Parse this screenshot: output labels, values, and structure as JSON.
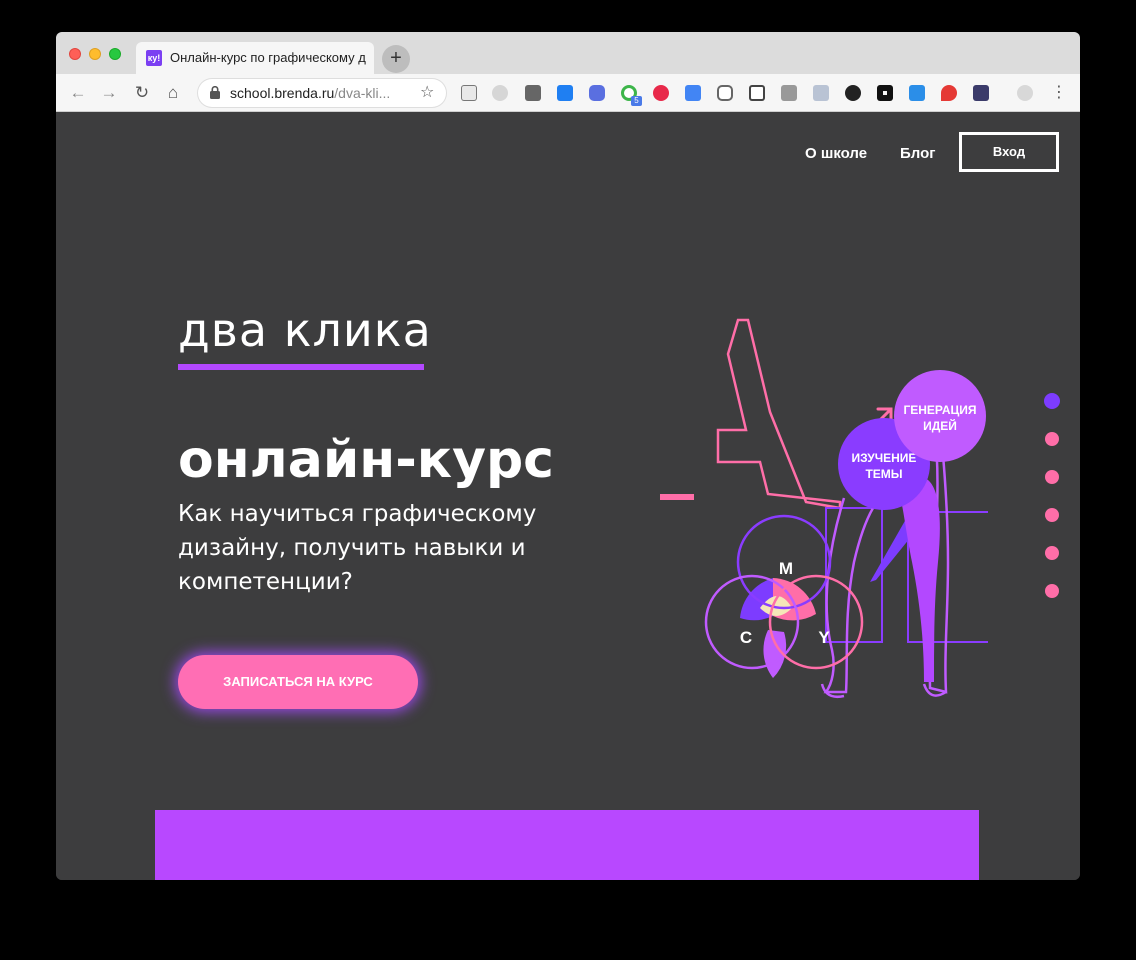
{
  "browser": {
    "tab_favicon": "ку!",
    "tab_title": "Онлайн-курс по графическому дизайну",
    "new_tab_symbol": "+",
    "url_host": "school.brenda.ru",
    "url_path": "/dva-kli..."
  },
  "nav": {
    "about": "О школе",
    "blog": "Блог",
    "login": "Вход"
  },
  "hero": {
    "brand": "два клика",
    "title": "онлайн-курс",
    "subtitle": "Как научиться графическому дизайну, получить навыки и компетенции?",
    "cta": "ЗАПИСАТЬСЯ НА КУРС"
  },
  "illustration": {
    "circle_research_line1": "ИЗУЧЕНИЕ",
    "circle_research_line2": "ТЕМЫ",
    "circle_ideas_line1": "ГЕНЕРАЦИЯ",
    "circle_ideas_line2": "ИДЕЙ",
    "venn_m": "M",
    "venn_c": "C",
    "venn_y": "Y"
  },
  "slider": {
    "slide_count": 6,
    "active_index": 0
  },
  "colors": {
    "background": "#3d3d3e",
    "accent_purple": "#b348ff",
    "accent_violet": "#7d3cff",
    "accent_pink": "#ff6eb4"
  }
}
